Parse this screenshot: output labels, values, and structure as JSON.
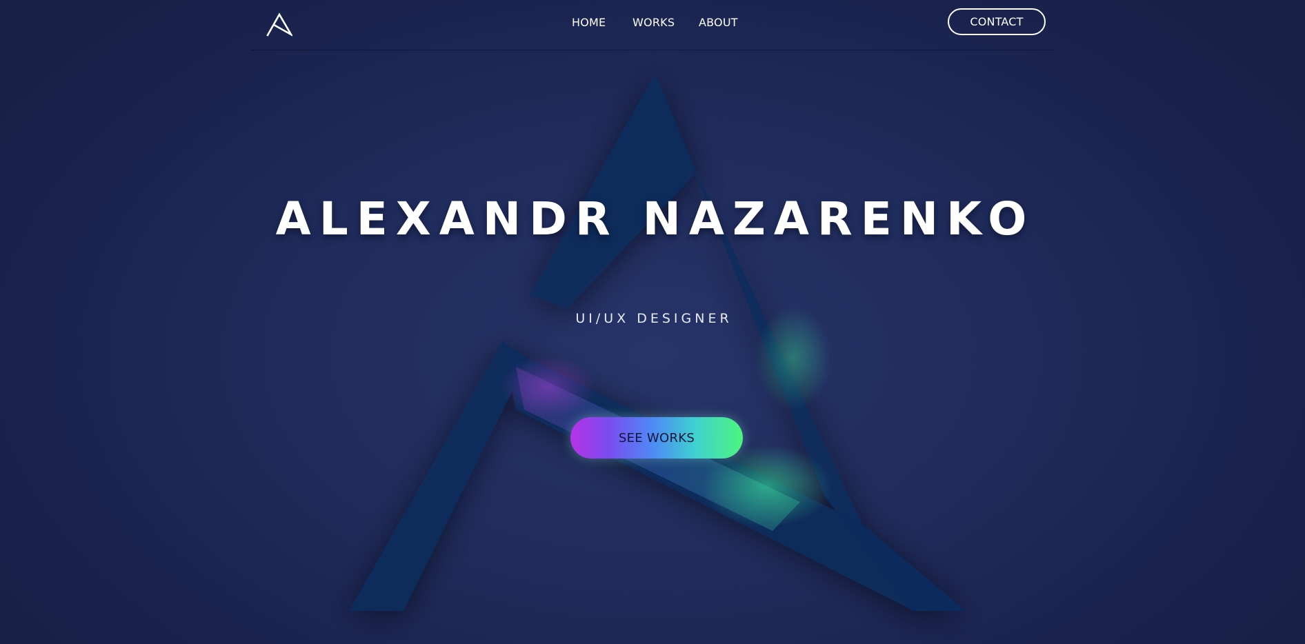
{
  "header": {
    "logo_name": "stylized-a-logo",
    "nav": [
      {
        "label": "HOME"
      },
      {
        "label": "WORKS"
      },
      {
        "label": "ABOUT"
      }
    ],
    "contact_label": "CONTACT"
  },
  "hero": {
    "title": "ALEXANDR NAZARENKO",
    "subtitle": "UI/UX DESIGNER",
    "cta_label": "SEE WORKS"
  },
  "colors": {
    "background": "#202c5c",
    "background_shape": "#0e2a5a",
    "text": "#ffffff",
    "cta_gradient_start": "#b632e6",
    "cta_gradient_mid": "#4e8bf5",
    "cta_gradient_end": "#4cf57e",
    "cta_text": "#101636"
  }
}
